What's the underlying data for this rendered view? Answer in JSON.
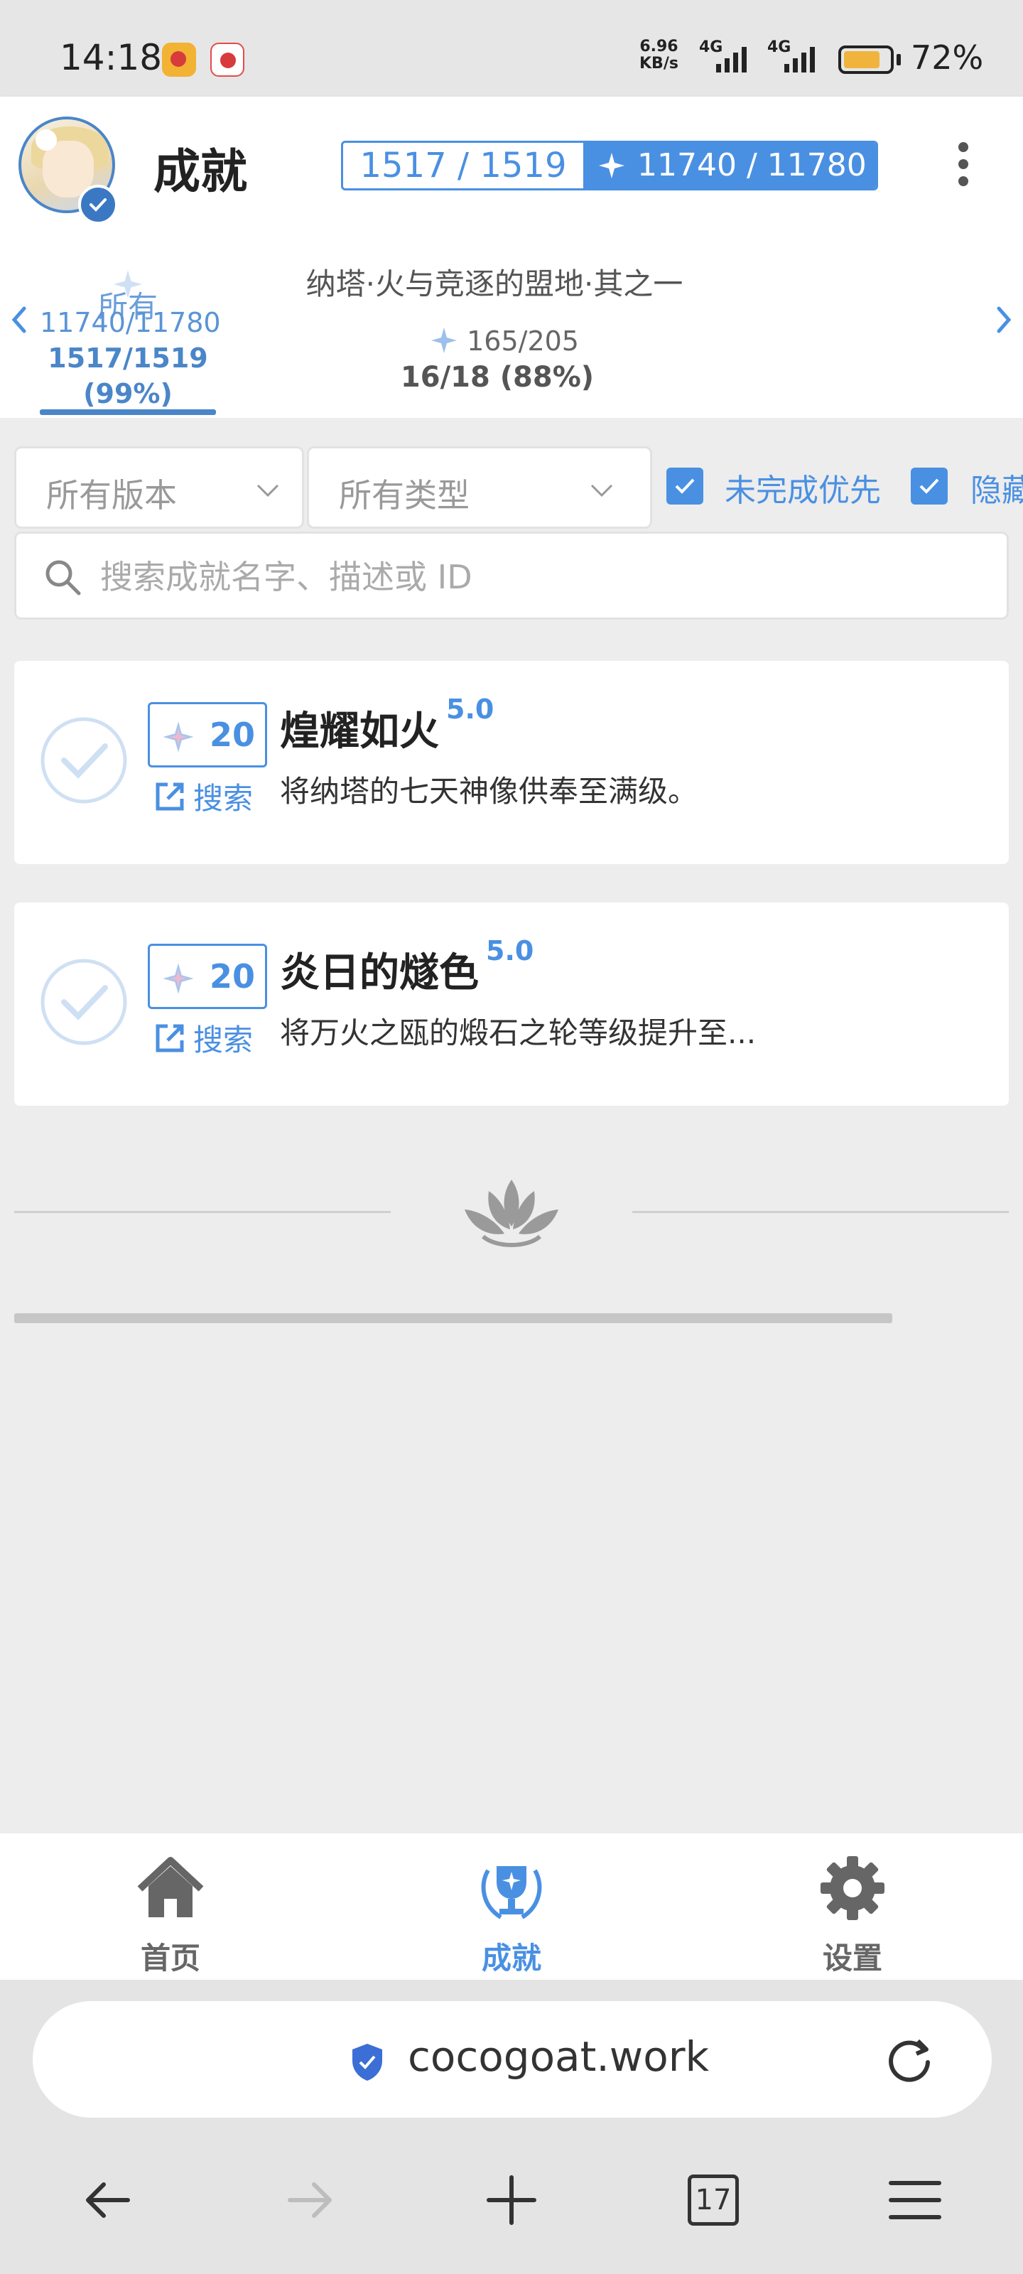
{
  "status_bar": {
    "time": "14:18",
    "net_speed_value": "6.96",
    "net_speed_unit": "KB/s",
    "network_1": "4G",
    "network_2": "4G",
    "battery": "72%"
  },
  "header": {
    "title": "成就",
    "achievement_progress": "1517 / 1519",
    "primogem_progress": "11740 / 11780",
    "menu_icon": "more-vertical-icon"
  },
  "categories": [
    {
      "name": "所有",
      "primogems": "11740/11780",
      "count": "1517/1519",
      "percent": "(99%)",
      "active": true
    },
    {
      "name": "纳塔·火与竞逐的盟地·其之一",
      "primogems": "165/205",
      "count": "16/18 (88%)",
      "active": false
    }
  ],
  "filters": {
    "version_select": "所有版本",
    "type_select": "所有类型",
    "checkbox_1_label": "未完成优先",
    "checkbox_1_checked": true,
    "checkbox_2_label": "隐藏",
    "checkbox_2_checked": true
  },
  "search": {
    "placeholder": "搜索成就名字、描述或 ID",
    "value": ""
  },
  "achievements": [
    {
      "reward": "20",
      "search_label": "搜索",
      "title": "煌耀如火",
      "version": "5.0",
      "description": "将纳塔的七天神像供奉至满级。"
    },
    {
      "reward": "20",
      "search_label": "搜索",
      "title": "炎日的燧色",
      "version": "5.0",
      "description": "将万火之瓯的煅石之轮等级提升至..."
    }
  ],
  "bottom_nav": {
    "home": "首页",
    "achievements": "成就",
    "settings": "设置"
  },
  "browser": {
    "url": "cocogoat.work",
    "tab_count": "17"
  },
  "colors": {
    "accent": "#4a90e2",
    "background": "#ededed"
  }
}
